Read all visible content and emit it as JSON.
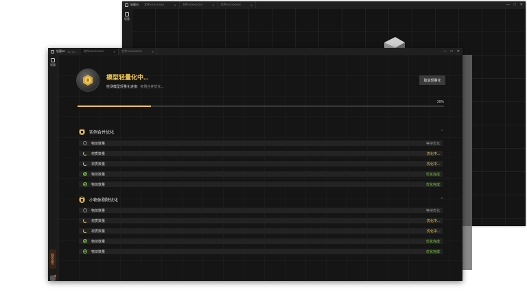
{
  "back_window": {
    "app_name": "轻量3D",
    "tabs": [
      "文件XXXXXXXX",
      "文件XXXXXXXX",
      "文件XXXXXXXX"
    ],
    "sidebar_label": "轻量"
  },
  "window": {
    "app_name": "轻量3D",
    "version": "V1.1.0",
    "tabs": [
      "文件XXXXXXXX",
      "文件XXXXXXXX"
    ],
    "controls": {
      "minimize": "—",
      "maximize": "□",
      "close": "✕"
    }
  },
  "sidebar": {
    "items": [
      {
        "label": "轻量",
        "icon": "cube-icon"
      }
    ],
    "vip_label": "我的会员"
  },
  "header": {
    "title": "模型轻量化中...",
    "subtitle_label": "检测模型轻量化进度:",
    "subtitle_value": "实例合并优化..."
  },
  "cancel_button": "取消轻量化",
  "progress": {
    "value": 0.2,
    "label": "20%"
  },
  "colors": {
    "accent": "#f2c74e",
    "done": "#7ac943",
    "wait": "#8f8f8f"
  },
  "sections": [
    {
      "title": "实例合并优化",
      "chevron": "^",
      "rows": [
        {
          "name": "物体数量",
          "status": "等待优化",
          "state": "wait"
        },
        {
          "name": "材质数量",
          "status": "优化中...",
          "state": "run"
        },
        {
          "name": "材质数量",
          "status": "优化中...",
          "state": "run"
        },
        {
          "name": "物体数量",
          "status": "优化完成",
          "state": "done"
        },
        {
          "name": "物体数量",
          "status": "优化完成",
          "state": "done"
        }
      ]
    },
    {
      "title": "小物体剔除优化",
      "chevron": "^",
      "rows": [
        {
          "name": "物体数量",
          "status": "等待优化",
          "state": "wait"
        },
        {
          "name": "材质数量",
          "status": "优化中...",
          "state": "run"
        },
        {
          "name": "材质数量",
          "status": "优化中...",
          "state": "run"
        },
        {
          "name": "物体数量",
          "status": "优化完成",
          "state": "done"
        },
        {
          "name": "物体数量",
          "status": "优化完成",
          "state": "done"
        }
      ]
    }
  ]
}
